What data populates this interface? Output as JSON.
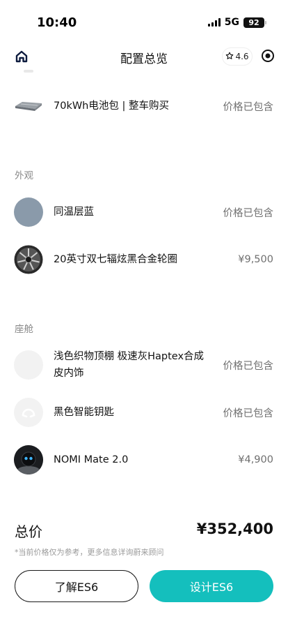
{
  "status_bar": {
    "time": "10:40",
    "network": "5G",
    "battery": "92"
  },
  "nav": {
    "title": "配置总览",
    "rating": "4.6"
  },
  "items_top": [
    {
      "label": "70kWh电池包 | 整车购买",
      "price": "价格已包含",
      "icon": "battery-pack-icon"
    }
  ],
  "sections": [
    {
      "title": "外观",
      "items": [
        {
          "label": "同温层蓝",
          "price": "价格已包含",
          "icon": "paint-swatch-icon",
          "color": "#8a9aaa"
        },
        {
          "label": "20英寸双七辐炫黑合金轮圈",
          "price": "¥9,500",
          "icon": "wheel-rim-icon"
        }
      ]
    },
    {
      "title": "座舱",
      "items": [
        {
          "label": "浅色织物顶棚 极速灰Haptex合成皮内饰",
          "price": "价格已包含",
          "icon": "interior-swatch-icon",
          "color": "#f2f2f2"
        },
        {
          "label": "黑色智能钥匙",
          "price": "价格已包含",
          "icon": "smart-key-icon"
        },
        {
          "label": "NOMI Mate 2.0",
          "price": "¥4,900",
          "icon": "nomi-robot-icon"
        }
      ]
    }
  ],
  "footer": {
    "total_label": "总价",
    "total_value": "¥352,400",
    "disclaimer": "*当前价格仅为参考，更多信息详询蔚来顾问",
    "learn_button": "了解ES6",
    "design_button": "设计ES6"
  },
  "colors": {
    "accent": "#14bfbd",
    "text": "#111111",
    "muted": "#6f6f6f"
  }
}
